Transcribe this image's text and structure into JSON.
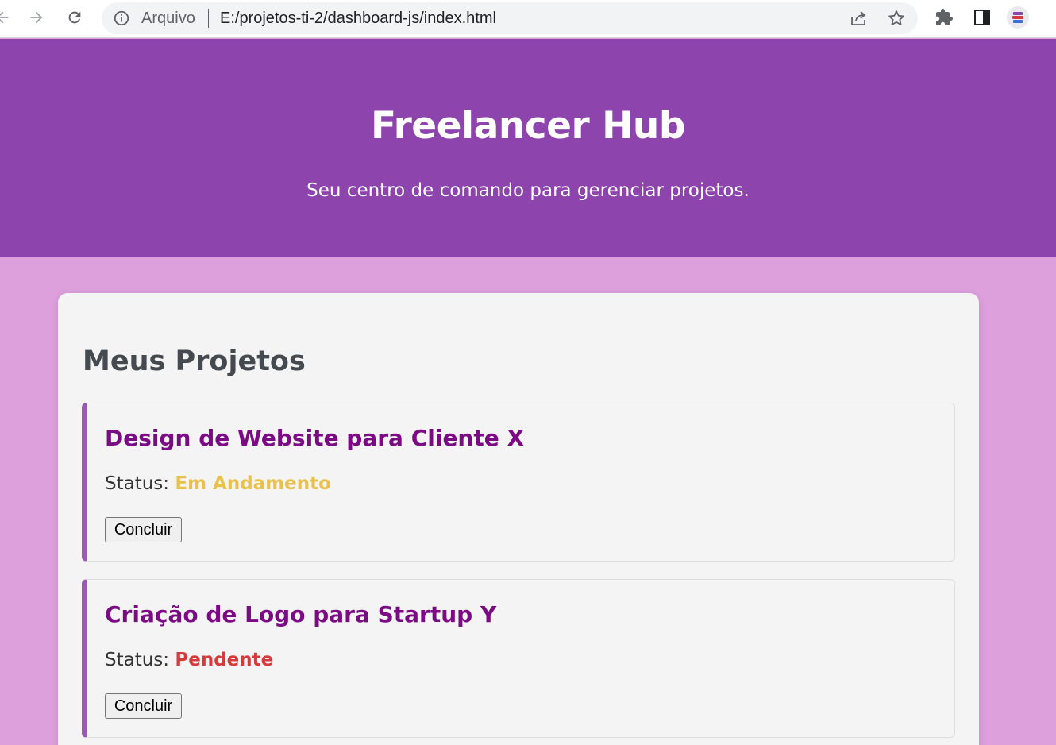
{
  "browser": {
    "site_label": "Arquivo",
    "url": "E:/projetos-ti-2/dashboard-js/index.html",
    "icons": [
      "back-arrow-icon",
      "forward-arrow-icon",
      "reload-icon",
      "info-icon",
      "share-icon",
      "star-icon",
      "extensions-icon",
      "side-panel-icon",
      "profile-icon"
    ]
  },
  "header": {
    "title": "Freelancer Hub",
    "subtitle": "Seu centro de comando para gerenciar projetos."
  },
  "main": {
    "section_title": "Meus Projetos",
    "projects": [
      {
        "title": "Design de Website para Cliente X",
        "status_label": "Status:",
        "status": "Em Andamento",
        "status_color": "#e9c14a",
        "button": "Concluir"
      },
      {
        "title": "Criação de Logo para Startup Y",
        "status_label": "Status:",
        "status": "Pendente",
        "status_color": "#d63b3b",
        "button": "Concluir"
      }
    ]
  },
  "colors": {
    "header_bg": "#8e44ad",
    "page_bg": "#dda0dd",
    "card_bg": "#f4f4f4",
    "accent_border": "#9b59b6",
    "project_title": "#7b0a84"
  }
}
